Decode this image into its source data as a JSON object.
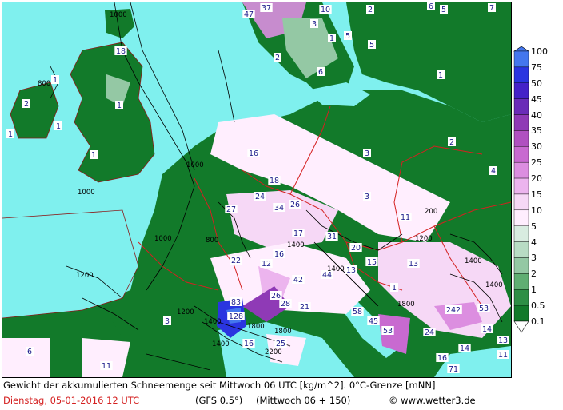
{
  "legend": {
    "labels": [
      "100",
      "75",
      "50",
      "45",
      "40",
      "35",
      "30",
      "25",
      "20",
      "15",
      "10",
      "5",
      "4",
      "3",
      "2",
      "1",
      "0.5",
      "0.1"
    ],
    "colors": [
      "#4477ee",
      "#2a35e0",
      "#4422c8",
      "#6a2cb8",
      "#8f3ab6",
      "#b050c0",
      "#c86ad0",
      "#dc8ee0",
      "#ecb4ee",
      "#f6d8f6",
      "#ffeefe",
      "#d8ece0",
      "#b8dcc4",
      "#94c8a4",
      "#5fae72",
      "#2e8f45",
      "#127a2a"
    ]
  },
  "footer": {
    "title": "Gewicht der akkumulierten Schneemenge seit Mittwoch 06 UTC [kg/m^2]. 0°C-Grenze [mNN]",
    "date": "Dienstag, 05-01-2016   12 UTC",
    "model": "(GFS 0.5°)",
    "run": "(Mittwoch 06 + 150)",
    "credit": "www.wetter3.de",
    "copyright_symbol": "©"
  },
  "map": {
    "snow_values": [
      {
        "t": "47"
      },
      {
        "t": "37"
      },
      {
        "t": "10"
      },
      {
        "t": "5"
      },
      {
        "t": "6"
      },
      {
        "t": "5"
      },
      {
        "t": "7"
      },
      {
        "t": "3"
      },
      {
        "t": "1"
      },
      {
        "t": "2"
      },
      {
        "t": "2"
      },
      {
        "t": "6"
      },
      {
        "t": "5"
      },
      {
        "t": "1"
      },
      {
        "t": "18"
      },
      {
        "t": "1"
      },
      {
        "t": "1"
      },
      {
        "t": "1"
      },
      {
        "t": "1"
      },
      {
        "t": "1"
      },
      {
        "t": "2"
      },
      {
        "t": "16"
      },
      {
        "t": "18"
      },
      {
        "t": "3"
      },
      {
        "t": "2"
      },
      {
        "t": "4"
      },
      {
        "t": "3"
      },
      {
        "t": "27"
      },
      {
        "t": "24"
      },
      {
        "t": "34"
      },
      {
        "t": "26"
      },
      {
        "t": "17"
      },
      {
        "t": "31"
      },
      {
        "t": "20"
      },
      {
        "t": "15"
      },
      {
        "t": "16"
      },
      {
        "t": "12"
      },
      {
        "t": "22"
      },
      {
        "t": "42"
      },
      {
        "t": "44"
      },
      {
        "t": "13"
      },
      {
        "t": "13"
      },
      {
        "t": "1"
      },
      {
        "t": "11"
      },
      {
        "t": "28"
      },
      {
        "t": "21"
      },
      {
        "t": "26"
      },
      {
        "t": "83"
      },
      {
        "t": "128"
      },
      {
        "t": "58"
      },
      {
        "t": "45"
      },
      {
        "t": "53"
      },
      {
        "t": "24"
      },
      {
        "t": "242"
      },
      {
        "t": "53"
      },
      {
        "t": "3"
      },
      {
        "t": "16"
      },
      {
        "t": "25"
      },
      {
        "t": "6"
      },
      {
        "t": "11"
      },
      {
        "t": "14"
      },
      {
        "t": "13"
      },
      {
        "t": "16"
      },
      {
        "t": "71"
      },
      {
        "t": "14"
      },
      {
        "t": "11"
      }
    ],
    "isolines": [
      "1000",
      "800",
      "1000",
      "1000",
      "1000",
      "800",
      "1200",
      "1200",
      "1400",
      "1400",
      "1400",
      "1200",
      "2200",
      "1400",
      "1800",
      "1800",
      "200",
      "1400",
      "1400",
      "1800"
    ]
  }
}
